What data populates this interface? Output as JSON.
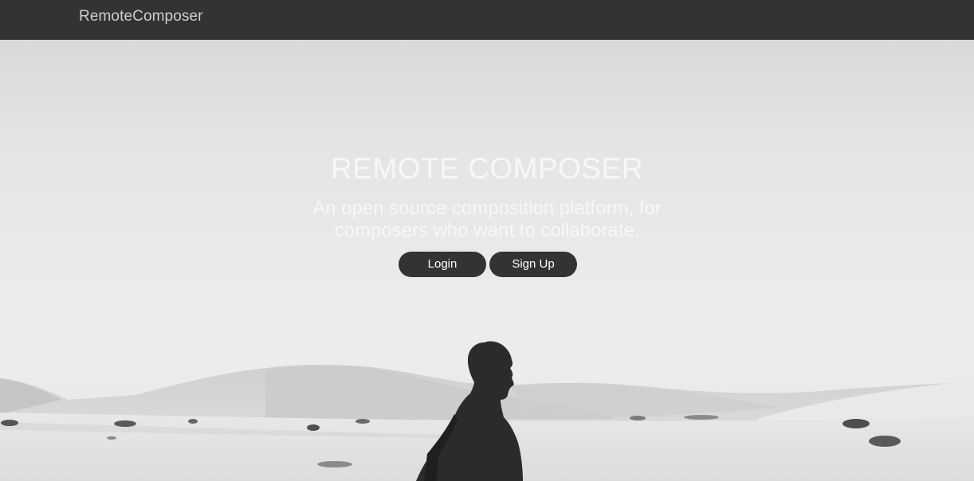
{
  "navbar": {
    "brand": "RemoteComposer"
  },
  "hero": {
    "title": "REMOTE COMPOSER",
    "subtitle": "An open source composition platform, for composers who want to collaborate.",
    "buttons": {
      "login": "Login",
      "signup": "Sign Up"
    }
  },
  "colors": {
    "navbar_bg": "#333333",
    "button_bg": "#333333",
    "brand_text": "#cfcfcf",
    "hero_text": "#f7f7f7"
  }
}
